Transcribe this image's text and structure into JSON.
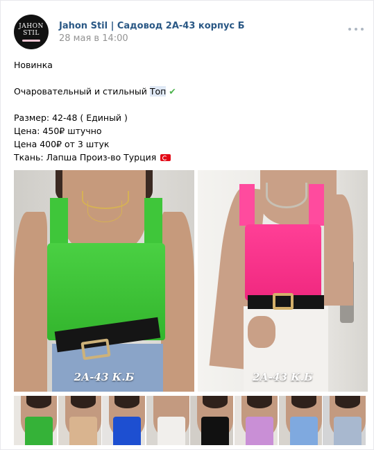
{
  "post": {
    "avatar_line1": "JAHON",
    "avatar_line2": "STIL",
    "author": "Jahon Stil | Садовод 2А-43 корпус Б",
    "date": "28 мая в 14:00",
    "more_icon": "more-horizontal-icon"
  },
  "text": {
    "line1": "Новинка",
    "line2_prefix": "Очаровательный и стильный ",
    "line2_highlight": "Топ",
    "line2_check": "✔",
    "size": "Размер: 42-48 ( Единый )",
    "price1": "Цена: 450₽ штучно",
    "price2": "Цена 400₽ от 3 штук",
    "fabric": "Ткань: Лапша Произ-во Турция",
    "flag_icon": "turkey-flag-icon"
  },
  "photos": [
    {
      "watermark": "2А-43 К.Б",
      "top_color": "#3fc63a"
    },
    {
      "watermark": "2А-43 К.Б",
      "top_color": "#ff3f96"
    }
  ],
  "thumbnails": [
    {
      "bg": "#e9e6e1",
      "shirt": "#35b238",
      "hair": true
    },
    {
      "bg": "#ded9d2",
      "shirt": "#d9b48f",
      "hair": true
    },
    {
      "bg": "#e6e4e2",
      "shirt": "#1d4fd1",
      "hair": true
    },
    {
      "bg": "#d9d6d1",
      "shirt": "#f1efec",
      "hair": false
    },
    {
      "bg": "#d2cec8",
      "shirt": "#111111",
      "hair": true
    },
    {
      "bg": "#e7e3df",
      "shirt": "#c98fd6",
      "hair": true
    },
    {
      "bg": "#d7d3cd",
      "shirt": "#7fa9df",
      "hair": true
    },
    {
      "bg": "#d3d4d6",
      "shirt": "#a8b8cf",
      "hair": true
    }
  ],
  "colors": {
    "link": "#2a5885",
    "muted": "#939393",
    "border": "#e7e8ec"
  }
}
